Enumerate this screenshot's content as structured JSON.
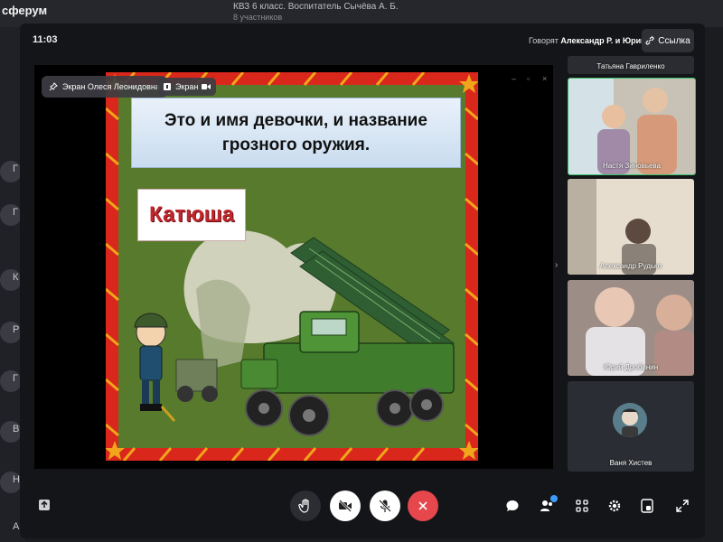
{
  "background_app": {
    "logo": "сферум",
    "chat_title": "КВЗ 6 класс. Воспитатель Сычёва А. Б.",
    "chat_subtitle": "8 участников",
    "left_initials": [
      "Г",
      "Г",
      "К",
      "Р",
      "Г",
      "В",
      "Н",
      "А"
    ]
  },
  "call": {
    "time": "11:03",
    "speaking_prefix": "Говорят",
    "speaking_names": "Александр Р. и Юрий Д.",
    "link_label": "Ссылка",
    "share_label": "Экран Олеся Леонидовна",
    "screen_label": "Экран",
    "window_controls": [
      "–",
      "▫",
      "×"
    ]
  },
  "slide": {
    "question_line1": "Это и имя девочки, и название",
    "question_line2": "грозного оружия.",
    "answer": "Катюша"
  },
  "participants": [
    {
      "name": "Татьяна Гавриленко"
    },
    {
      "name": "Настя Зиновьева"
    },
    {
      "name": "Александр Рудько"
    },
    {
      "name": "Юрий Дробинин"
    },
    {
      "name": "Ваня Хистев"
    }
  ],
  "colors": {
    "accent_green": "#3cc46a",
    "end_call_red": "#e5474d",
    "slide_green": "#577a2c",
    "frame_red": "#d9271c",
    "frame_gold": "#f0a51b",
    "answer_red": "#c1272d"
  },
  "icons": {
    "upload": "upload-icon",
    "hand": "raise-hand-icon",
    "camera_off": "camera-off-icon",
    "mic_off": "mic-off-icon",
    "end_call": "end-call-icon",
    "chat": "chat-icon",
    "participants": "participants-icon",
    "grid": "grid-icon",
    "settings": "gear-icon",
    "pip": "pip-icon",
    "fullscreen": "fullscreen-icon"
  }
}
